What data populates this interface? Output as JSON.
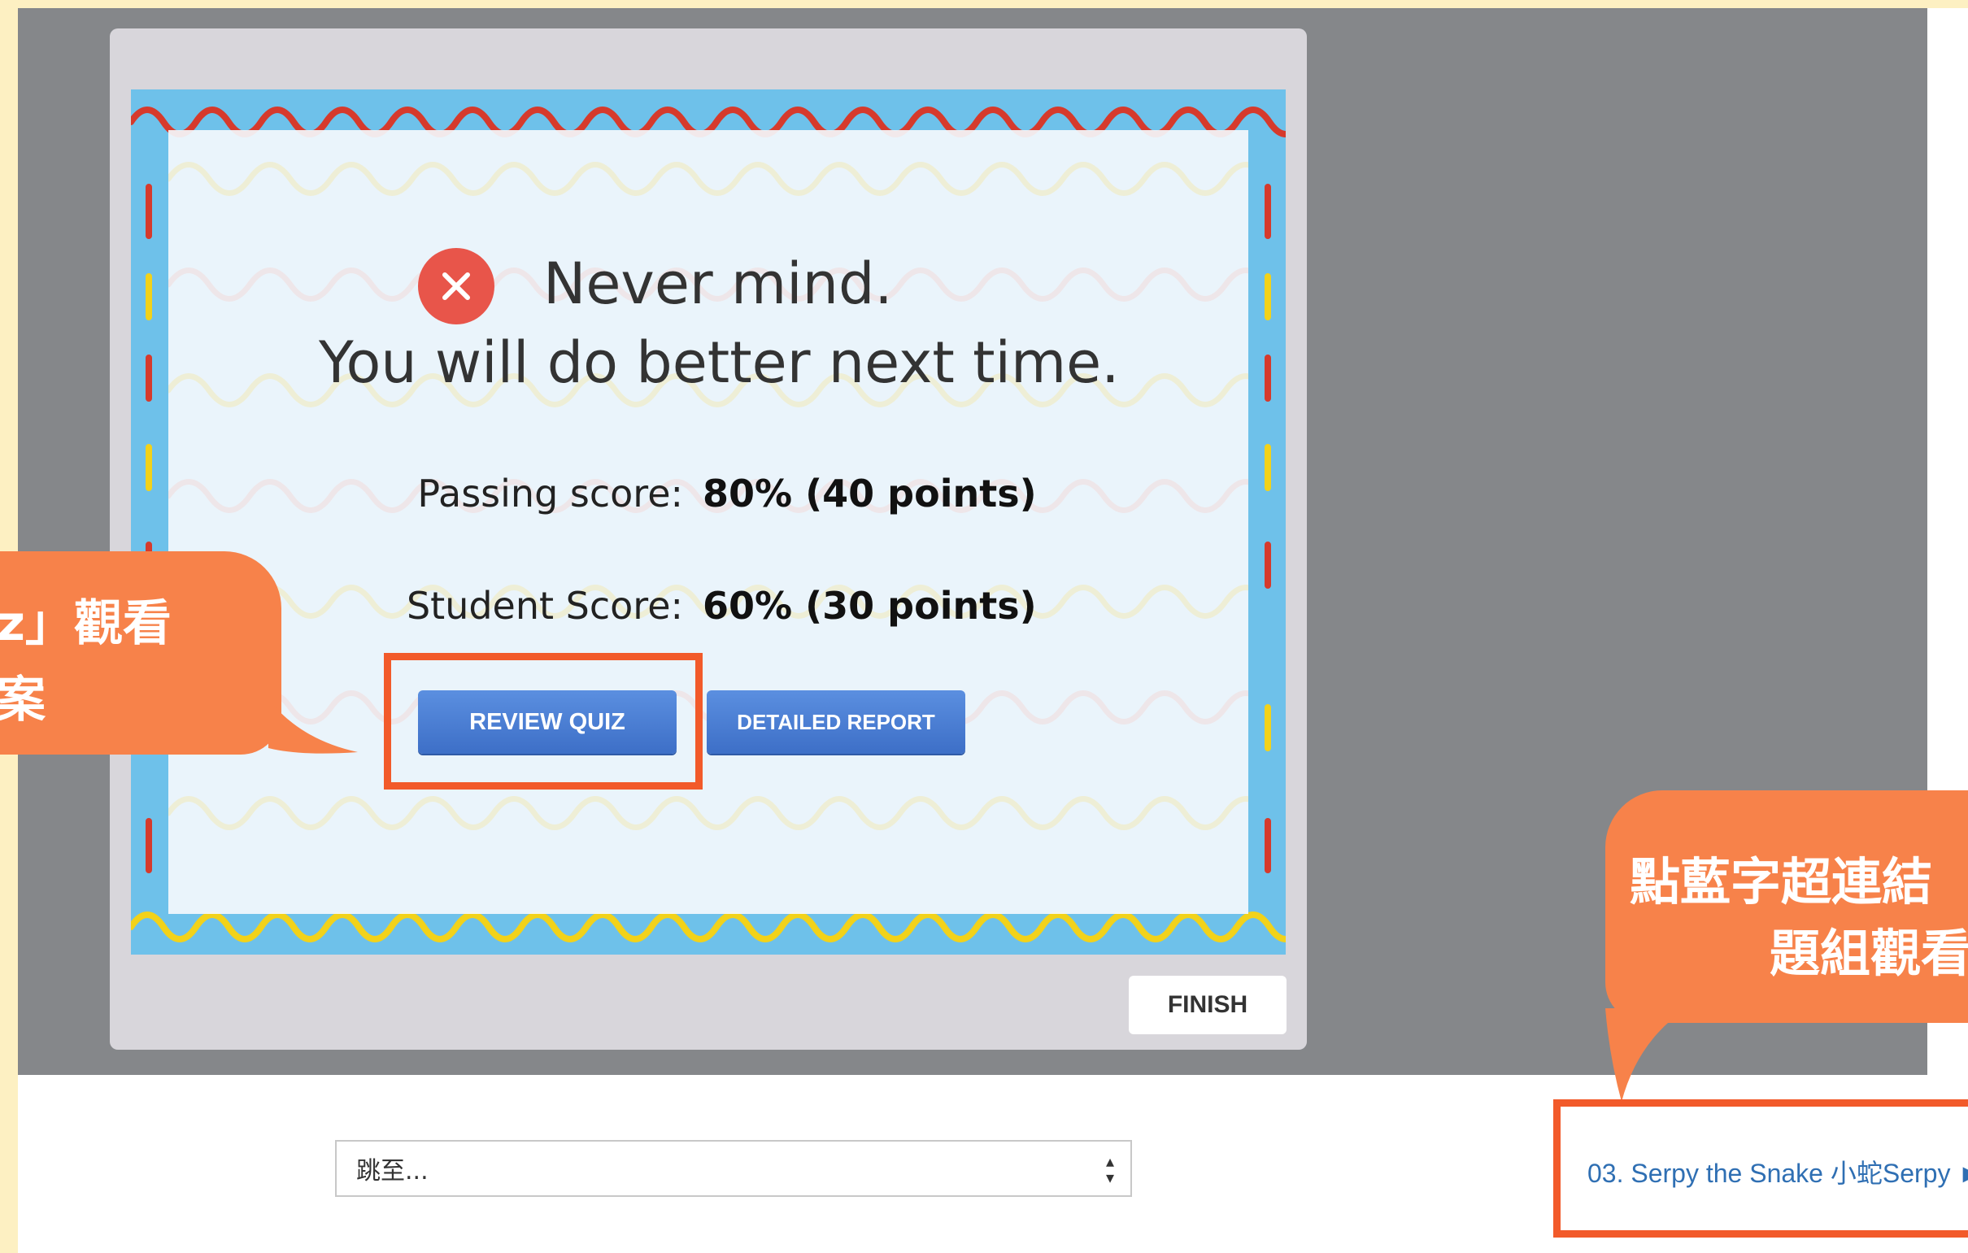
{
  "result": {
    "heading": "Never mind.",
    "subheading": "You will do better next time.",
    "passing_label": "Passing score:",
    "passing_value": "80% (40 points)",
    "student_label": "Student Score:",
    "student_value": "60% (30 points)"
  },
  "buttons": {
    "review": "REVIEW QUIZ",
    "detail": "DETAILED REPORT",
    "finish": "FINISH"
  },
  "navigation": {
    "jump_placeholder": "跳至...",
    "next_link": "03. Serpy the Snake 小蛇Serpy ►"
  },
  "callouts": {
    "left_line1": "z」觀看",
    "left_line2": "案",
    "right_line1": "點藍字超連結",
    "right_line2": "題組觀看"
  },
  "colors": {
    "accent_orange": "#f7824a",
    "highlight_red": "#f25a2a",
    "button_blue": "#4a7fd6",
    "error_red": "#e8554a",
    "link_blue": "#2f6fb3"
  },
  "icons": {
    "result_icon": "close-circle-icon",
    "select_icon": "up-down-arrows-icon"
  }
}
